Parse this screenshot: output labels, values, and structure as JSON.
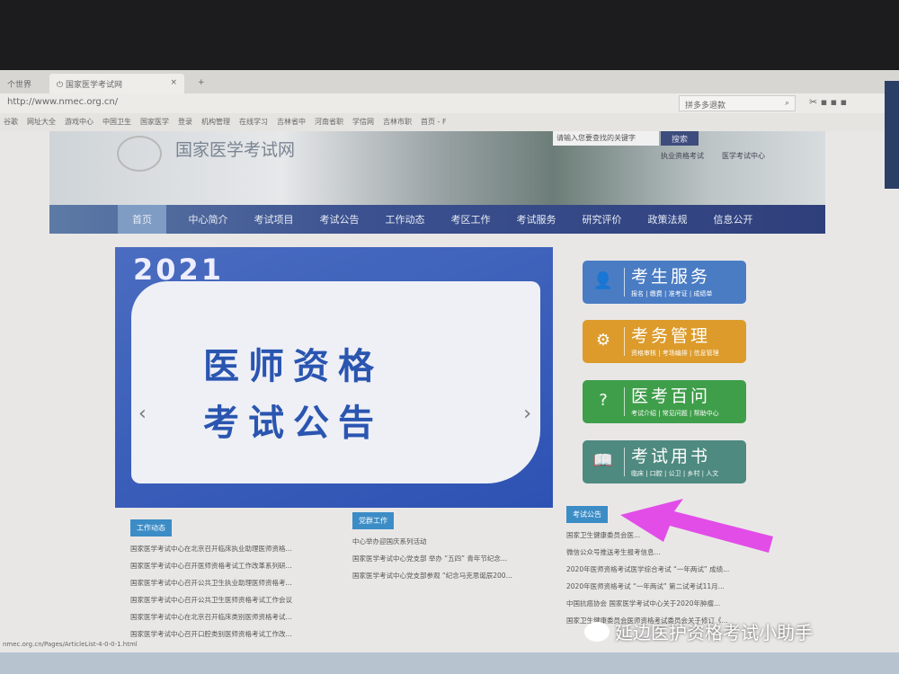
{
  "browser": {
    "prev_tab": "个世界",
    "active_tab": "国家医学考试网",
    "url": "http://www.nmec.org.cn/",
    "search": "拼多多退款",
    "bookmarks": [
      "谷歌",
      "网址大全",
      "游戏中心",
      "中国卫生",
      "国家医学",
      "登录",
      "机构管理",
      "在线学习",
      "吉林省中",
      "河南省职",
      "学信网",
      "吉林市职",
      "首页 - F"
    ],
    "status_url": "nmec.org.cn/Pages/ArticleList-4-0-0-1.html"
  },
  "header": {
    "site_title": "国家医学考试网",
    "search_placeholder": "请输入您要查找的关键字",
    "search_button": "搜索",
    "links": [
      "执业资格考试",
      "医学考试中心"
    ]
  },
  "nav": [
    "首页",
    "中心简介",
    "考试项目",
    "考试公告",
    "工作动态",
    "考区工作",
    "考试服务",
    "研究评价",
    "政策法规",
    "信息公开"
  ],
  "carousel": {
    "year": "2021",
    "line1": "医师资格",
    "line2": "考试公告"
  },
  "services": [
    {
      "title": "考生服务",
      "sub": "报名 | 缴费 | 准考证 | 成绩单",
      "icon": "user-icon",
      "color": "#4a7cc4"
    },
    {
      "title": "考务管理",
      "sub": "资格审核 | 考场编排 | 信息管理",
      "icon": "gear-icon",
      "color": "#dc9b2a"
    },
    {
      "title": "医考百问",
      "sub": "考试介绍 | 常见问题 | 帮助中心",
      "icon": "question-icon",
      "color": "#3f9e4a"
    },
    {
      "title": "考试用书",
      "sub": "临床 | 口腔 | 公卫 | 乡村 | 人文",
      "icon": "book-icon",
      "color": "#4e8a80"
    }
  ],
  "sections": [
    {
      "title": "工作动态",
      "items": [
        "国家医学考试中心在北京召开临床执业助理医师资格...",
        "国家医学考试中心召开医师资格考试工作改革系列研...",
        "国家医学考试中心召开公共卫生执业助理医师资格考...",
        "国家医学考试中心召开公共卫生医师资格考试工作会议",
        "国家医学考试中心在北京召开临床类别医师资格考试...",
        "国家医学考试中心召开口腔类别医师资格考试工作改..."
      ]
    },
    {
      "title": "党群工作",
      "items": [
        "中心举办迎国庆系列活动",
        "国家医学考试中心党支部 举办 “五四” 青年节纪念...",
        "国家医学考试中心党支部参观 “纪念马克思诞辰200..."
      ]
    },
    {
      "title": "考试公告",
      "items": [
        "国家卫生健康委员会医...",
        "微信公众号推送考生报考信息...",
        "2020年医师资格考试医学综合考试 “一年两试” 成绩...",
        "2020年医师资格考试 “一年两试” 第二试考试11月...",
        "中国抗癌协会 国家医学考试中心关于2020年肿瘤...",
        "国家卫生健康委员会医师资格考试委员会关于修订《..."
      ]
    }
  ],
  "watermark": "延边医护资格考试小助手"
}
